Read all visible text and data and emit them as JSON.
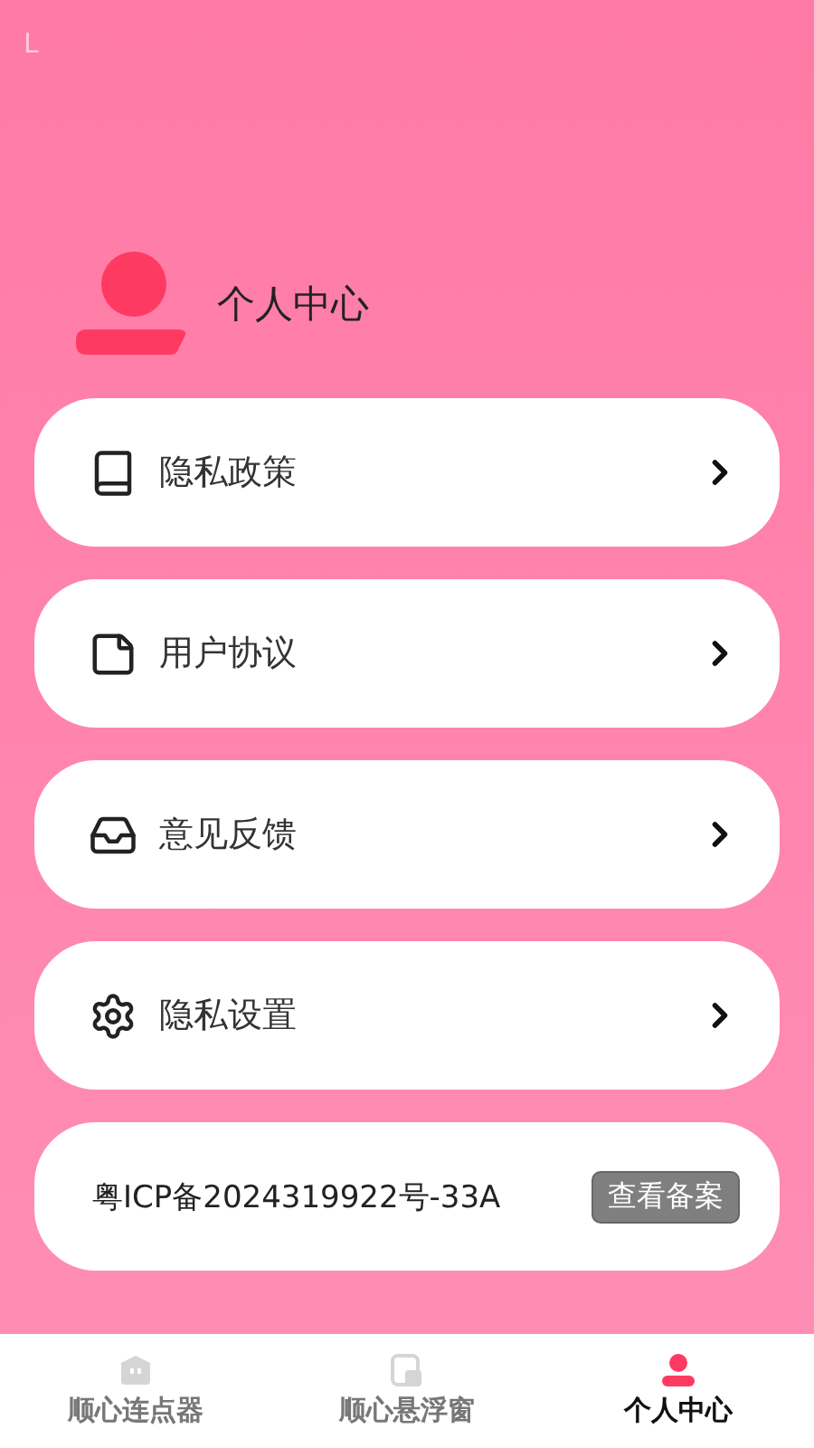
{
  "status_bar": {
    "text": "L"
  },
  "profile": {
    "title": "个人中心"
  },
  "menu": [
    {
      "label": "隐私政策"
    },
    {
      "label": "用户协议"
    },
    {
      "label": "意见反馈"
    },
    {
      "label": "隐私设置"
    }
  ],
  "icp": {
    "number": "粤ICP备2024319922号-33A",
    "button": "查看备案"
  },
  "tabs": [
    {
      "label": "顺心连点器",
      "selected": false
    },
    {
      "label": "顺心悬浮窗",
      "selected": false
    },
    {
      "label": "个人中心",
      "selected": true
    }
  ]
}
